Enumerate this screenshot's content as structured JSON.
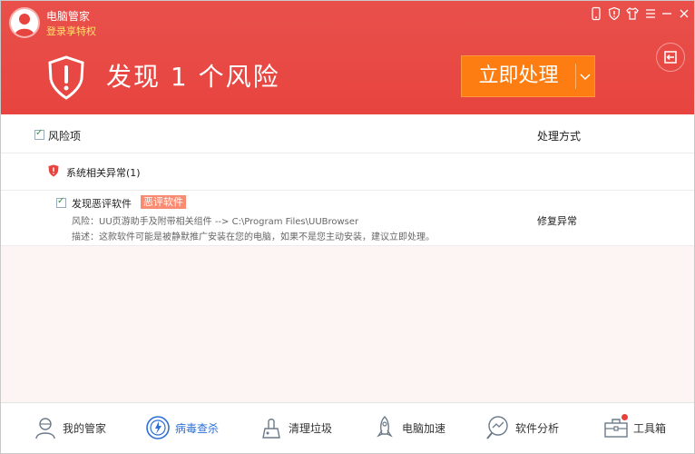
{
  "header": {
    "user_name": "电脑管家",
    "login_link": "登录享特权",
    "risk_title": "发现 1 个风险",
    "action_button": "立即处理"
  },
  "window_controls": [
    "phone-icon",
    "shield-icon",
    "shirt-icon",
    "menu-icon",
    "minimize-icon",
    "close-icon"
  ],
  "list": {
    "header_risk": "风险项",
    "header_method": "处理方式",
    "group": {
      "label": "系统相关异常(1)"
    },
    "item": {
      "name": "发现恶评软件",
      "badge": "恶评软件",
      "risk": "风险：UU页游助手及附带相关组件 --> C:\\Program Files\\UUBrowser",
      "desc": "描述：这款软件可能是被静默推广安装在您的电脑，如果不是您主动安装，建议立即处理。",
      "action": "修复异常"
    }
  },
  "bottom_nav": [
    {
      "label": "我的管家",
      "icon": "person-icon"
    },
    {
      "label": "病毒查杀",
      "icon": "virus-scan-icon",
      "active": true
    },
    {
      "label": "清理垃圾",
      "icon": "vacuum-icon"
    },
    {
      "label": "电脑加速",
      "icon": "rocket-icon"
    },
    {
      "label": "软件分析",
      "icon": "magnifier-chart-icon"
    },
    {
      "label": "工具箱",
      "icon": "toolbox-icon"
    }
  ],
  "colors": {
    "header_red": "#e7443f",
    "action_orange": "#fd7d12",
    "badge": "#f98b72",
    "active_blue": "#2d6fd5",
    "empty_bg": "#fdf4f4"
  }
}
